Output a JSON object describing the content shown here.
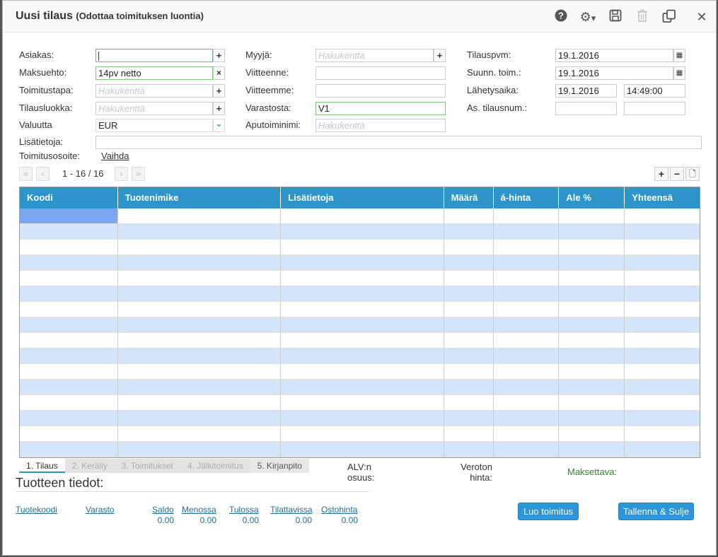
{
  "title": {
    "main": "Uusi tilaus",
    "sub": "(Odottaa toimituksen luontia)"
  },
  "toolbar": {
    "help": "?",
    "gear": "⚙",
    "caret": "▾",
    "save": "💾",
    "trash": "🗑",
    "copy": "⧉",
    "close": "✕"
  },
  "form": {
    "asiakas_label": "Asiakas:",
    "asiakas_value": "",
    "asiakas_btn": "+",
    "maksuehto_label": "Maksuehto:",
    "maksuehto_value": "14pv netto",
    "maksuehto_btn": "×",
    "toimitustapa_label": "Toimitustapa:",
    "toimitustapa_placeholder": "Hakukenttä",
    "toimitustapa_btn": "+",
    "tilausluokka_label": "Tilausluokka:",
    "tilausluokka_placeholder": "Hakukenttä",
    "tilausluokka_btn": "+",
    "valuutta_label": "Valuutta",
    "valuutta_value": "EUR",
    "valuutta_btn": "⌄",
    "myyja_label": "Myyjä:",
    "myyja_placeholder": "Hakukenttä",
    "myyja_btn": "+",
    "viitteenne_label": "Viitteenne:",
    "viitteenne_value": "",
    "viitteemme_label": "Viitteemme:",
    "viitteemme_value": "",
    "varastosta_label": "Varastosta:",
    "varastosta_value": "V1",
    "aputoiminimi_label": "Aputoiminimi:",
    "aputoiminimi_placeholder": "Hakukenttä",
    "tilauspvm_label": "Tilauspvm:",
    "tilauspvm_value": "19.1.2016",
    "tilauspvm_btn": "▦",
    "suunn_label": "Suunn. toim.:",
    "suunn_value": "19.1.2016",
    "suunn_btn": "▦",
    "lahetysaika_label": "Lähetysaika:",
    "lahetysaika_date": "19.1.2016",
    "lahetysaika_time": "14:49:00",
    "astilausnum_label": "As. tilausnum.:",
    "astilausnum_value1": "",
    "astilausnum_value2": "",
    "lisatietoja_label": "Lisätietoja:",
    "lisatietoja_value": "",
    "toimitusosoite_label": "Toimitusosoite:",
    "toimitusosoite_link": "Vaihda"
  },
  "pager": {
    "first": "«",
    "prev": "‹",
    "next": "›",
    "last": "»",
    "range": "1 - 16 / 16",
    "add": "+",
    "remove": "−",
    "doc": "🗋"
  },
  "grid": {
    "columns": [
      "Koodi",
      "Tuotenimike",
      "Lisätietoja",
      "Määrä",
      "á-hinta",
      "Ale %",
      "Yhteensä"
    ],
    "row_count": 16
  },
  "tabs": [
    "1. Tilaus",
    "2. Keräily",
    "3. Toimitukset",
    "4. Jälkitoimitus",
    "5. Kirjanpito"
  ],
  "totals": {
    "alv_line1": "ALV:n",
    "alv_line2": "osuus:",
    "veroton_line1": "Veroton",
    "veroton_line2": "hinta:",
    "maksettava": "Maksettava:"
  },
  "product_info": {
    "title": "Tuotteen tiedot:",
    "tuotekoodi": "Tuotekoodi",
    "varasto": "Varasto",
    "saldo": "Saldo",
    "menossa": "Menossa",
    "tulossa": "Tulossa",
    "tilattavissa": "Tilattavissa",
    "ostohinta": "Ostohinta",
    "saldo_value": "0.00",
    "menossa_value": "0.00",
    "tulossa_value": "0.00",
    "tilattavissa_value": "0.00",
    "ostohinta_value": "0.00"
  },
  "buttons": {
    "luo_toimitus": "Luo toimitus",
    "tallenna_sulje": "Tallenna & Sulje"
  }
}
